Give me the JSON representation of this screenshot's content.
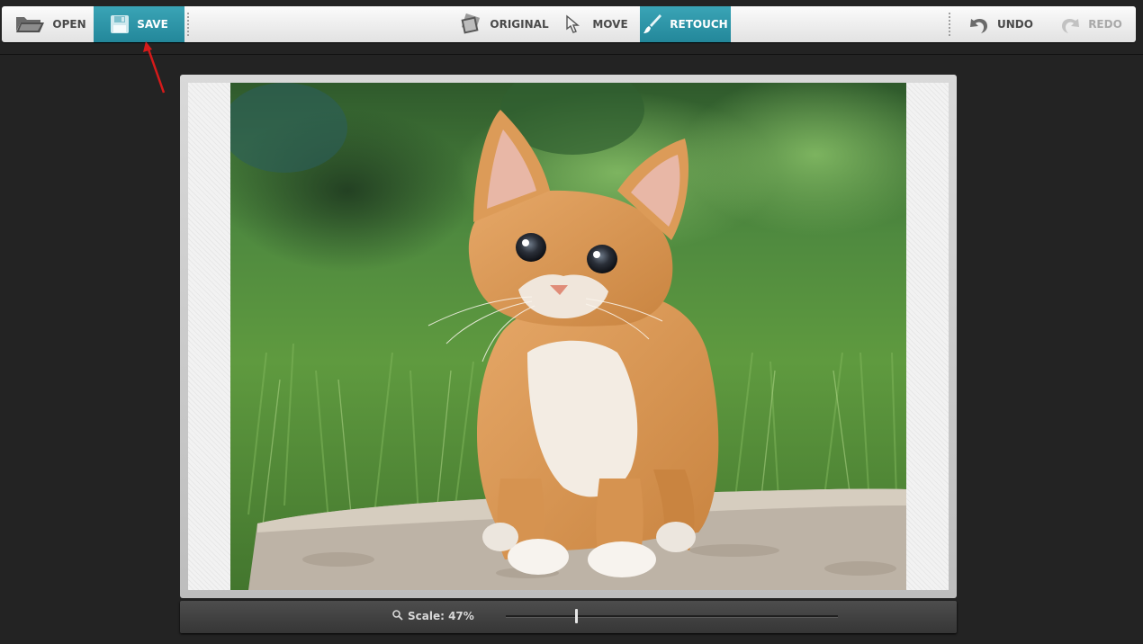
{
  "toolbar": {
    "open_label": "OPEN",
    "save_label": "SAVE",
    "original_label": "ORIGINAL",
    "move_label": "MOVE",
    "retouch_label": "RETOUCH",
    "undo_label": "UNDO",
    "redo_label": "REDO",
    "active_items": [
      "save",
      "retouch"
    ],
    "disabled_items": [
      "redo"
    ]
  },
  "icons": {
    "open": "folder-open-icon",
    "save": "floppy-disk-icon",
    "original": "image-stack-icon",
    "move": "move-cursor-icon",
    "retouch": "brush-icon",
    "undo": "undo-arrow-icon",
    "redo": "redo-arrow-icon",
    "scale": "magnifier-icon"
  },
  "canvas": {
    "image_subject": "orange tabby kitten on a stone in grass"
  },
  "scale": {
    "label": "Scale: 47%",
    "value_percent": 47
  },
  "colors": {
    "accent": "#2f97aa",
    "annotation_arrow": "#d51a1a",
    "background": "#232323"
  }
}
